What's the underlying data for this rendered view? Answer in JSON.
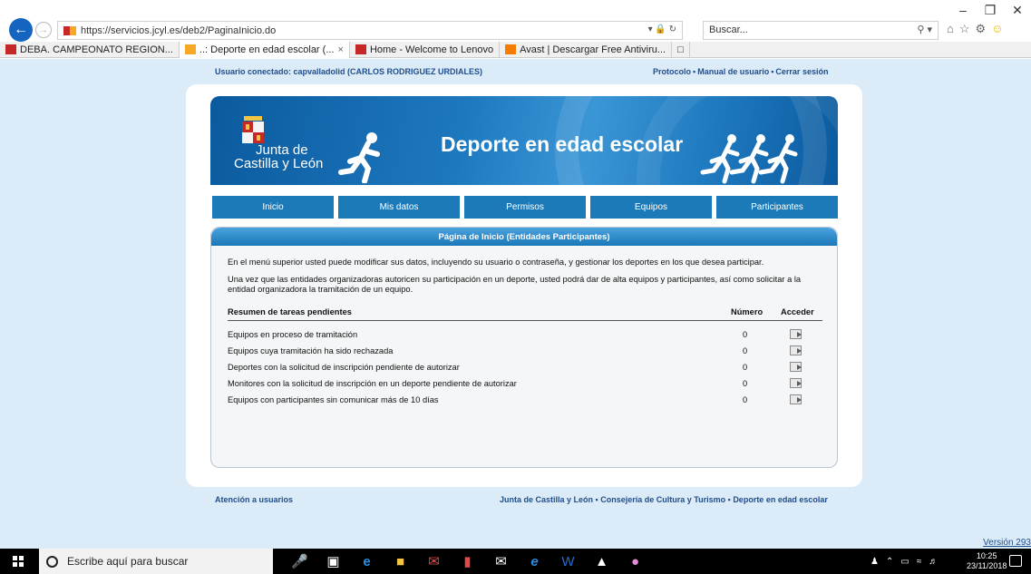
{
  "browser": {
    "url": "https://servicios.jcyl.es/deb2/PaginaInicio.do",
    "search_placeholder": "Buscar...",
    "tabs": [
      {
        "label": "DEBA. CAMPEONATO REGION...",
        "icon": "gmail-icon",
        "active": false,
        "color": "#c62828"
      },
      {
        "label": "..: Deporte en edad escolar (...",
        "icon": "jcyl-icon",
        "active": true,
        "color": "#f9a825",
        "close": "×"
      },
      {
        "label": "Home - Welcome to Lenovo",
        "icon": "lenovo-icon",
        "active": false,
        "color": "#c62828"
      },
      {
        "label": "Avast | Descargar Free Antiviru...",
        "icon": "avast-icon",
        "active": false,
        "color": "#f57c00"
      }
    ]
  },
  "header": {
    "user": "Usuario conectado: capvalladolid (CARLOS RODRIGUEZ URDIALES)",
    "links": [
      "Protocolo",
      "Manual de usuario",
      "Cerrar sesión"
    ]
  },
  "banner": {
    "org_line1": "Junta de",
    "org_line2": "Castilla y León",
    "title": "Deporte en edad escolar"
  },
  "menu": [
    "Inicio",
    "Mis datos",
    "Permisos",
    "Equipos",
    "Participantes"
  ],
  "main": {
    "heading": "Página de Inicio (Entidades Participantes)",
    "intro1": "En el menú superior usted puede modificar sus datos, incluyendo su usuario o contraseña, y gestionar los deportes en los que desea participar.",
    "intro2": "Una vez que las entidades organizadoras autoricen su participación en un deporte, usted podrá dar de alta equipos y participantes, así como solicitar a la entidad organizadora la tramitación de un equipo.",
    "table": {
      "col_task": "Resumen de tareas pendientes",
      "col_number": "Número",
      "col_access": "Acceder",
      "rows": [
        {
          "task": "Equipos en proceso de tramitación",
          "number": "0"
        },
        {
          "task": "Equipos cuya tramitación ha sido rechazada",
          "number": "0"
        },
        {
          "task": "Deportes con la solicitud de inscripción pendiente de autorizar",
          "number": "0"
        },
        {
          "task": "Monitores con la solicitud de inscripción en un deporte pendiente de autorizar",
          "number": "0"
        },
        {
          "task": "Equipos con participantes sin comunicar más de 10 días",
          "number": "0"
        }
      ]
    }
  },
  "footer": {
    "left": "Atención a usuarios",
    "links": [
      "Junta de Castilla y León",
      "Consejería de Cultura y Turismo",
      "Deporte en edad escolar"
    ],
    "version": "Versión 293"
  },
  "taskbar": {
    "search_placeholder": "Escribe aquí para buscar",
    "time": "10:25",
    "date": "23/11/2018"
  },
  "colors": {
    "accent": "#1d7ab8",
    "page_bg": "#dcebf8",
    "link": "#1f4e8c"
  }
}
